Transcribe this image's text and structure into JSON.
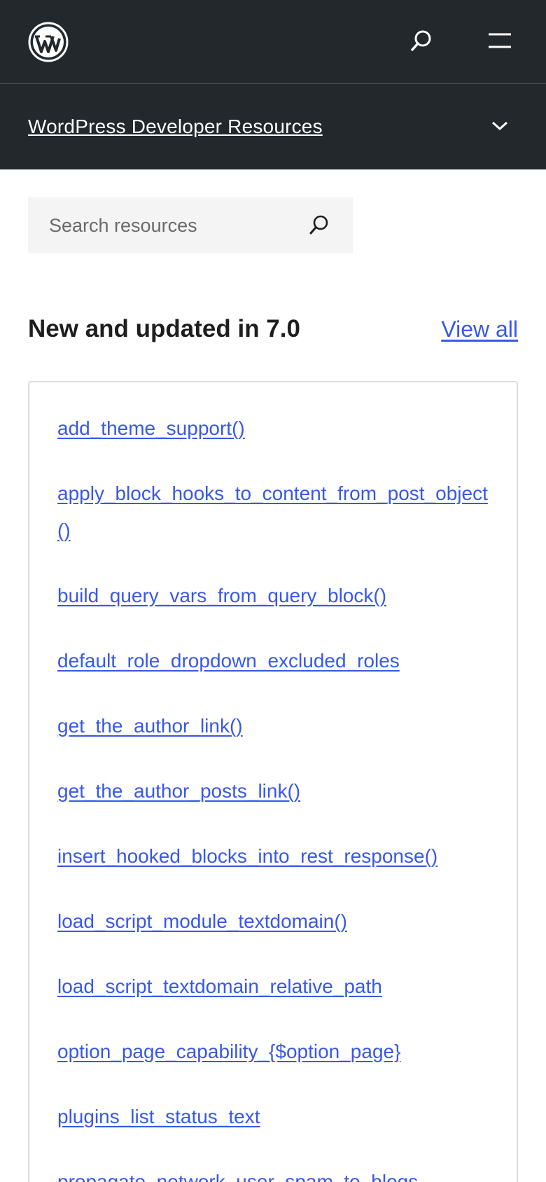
{
  "header": {
    "logo_icon": "wordpress-logo-icon",
    "search_icon": "search-icon",
    "menu_icon": "menu-icon"
  },
  "local_nav": {
    "title": "WordPress Developer Resources",
    "toggle_icon": "chevron-down-icon"
  },
  "search": {
    "placeholder": "Search resources",
    "icon": "search-icon"
  },
  "section": {
    "title": "New and updated in 7.0",
    "view_all_label": "View all"
  },
  "links": [
    "add_theme_support()",
    "apply_block_hooks_to_content_from_post_object()",
    "build_query_vars_from_query_block()",
    "default_role_dropdown_excluded_roles",
    "get_the_author_link()",
    "get_the_author_posts_link()",
    "insert_hooked_blocks_into_rest_response()",
    "load_script_module_textdomain()",
    "load_script_textdomain_relative_path",
    "option_page_capability_{$option_page}",
    "plugins_list_status_text",
    "propagate_network_user_spam_to_blogs"
  ],
  "colors": {
    "header_bg": "#23282d",
    "link": "#3858e9",
    "search_bg": "#f4f4f4"
  }
}
